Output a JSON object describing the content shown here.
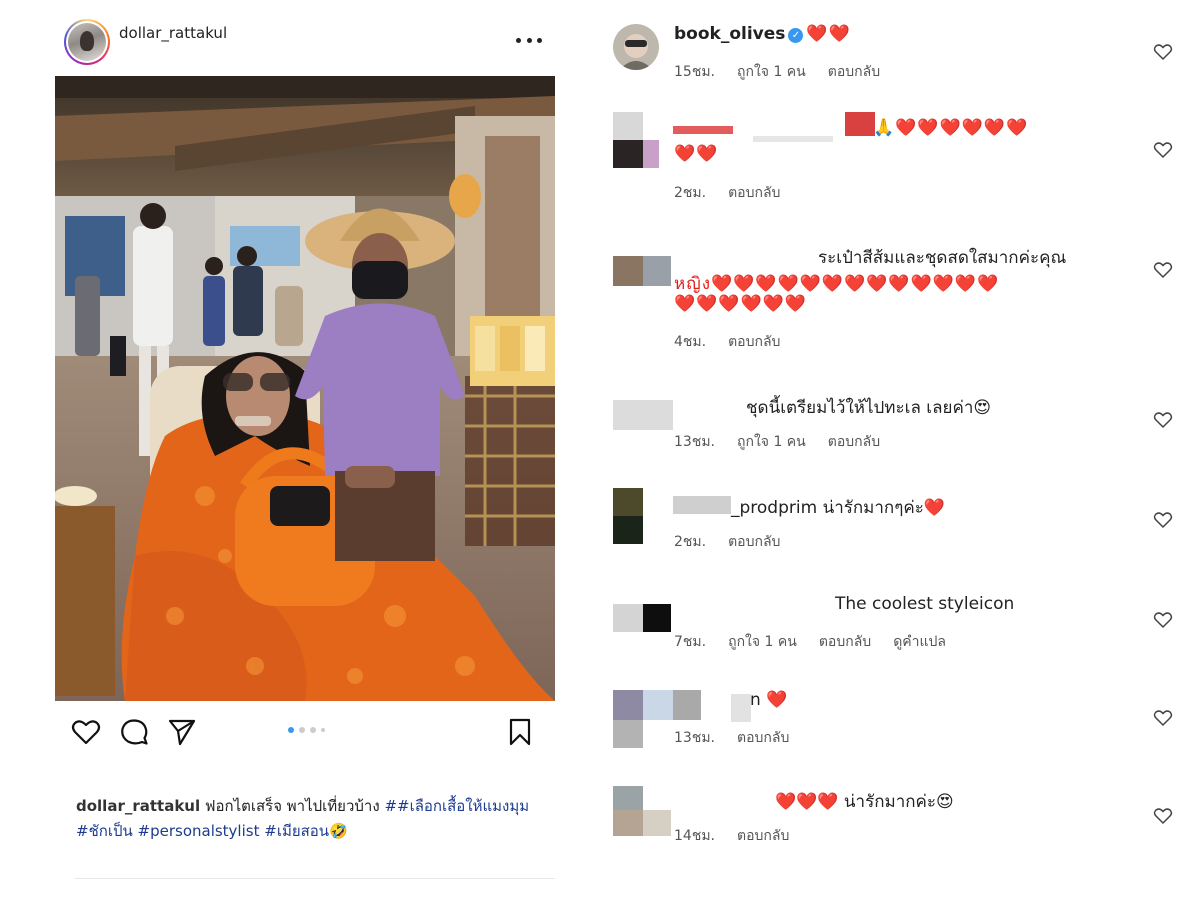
{
  "post": {
    "username": "dollar_rattakul",
    "caption_user": "dollar_rattakul",
    "caption_text": " ฟอกไตเสร็จ พาไปเที่ยวบ้าง ",
    "tag1": "##เลือกเสื้อให้แมงมุม",
    "tag2": "#ชักเป็น",
    "tag3": "#personalstylist",
    "tag4": "#เมียสอน",
    "caption_emoji": "🤣",
    "carousel_count": 4,
    "carousel_active": 1
  },
  "comments": [
    {
      "username": "book_olives",
      "text": "❤️❤️",
      "verified": true,
      "time": "15ชม.",
      "likes": "ถูกใจ 1 คน",
      "reply": "ตอบกลับ"
    },
    {
      "text_line1": "🙏❤️❤️❤️❤️❤️❤️",
      "text_line2": "❤️❤️",
      "time": "2ชม.",
      "reply": "ตอบกลับ"
    },
    {
      "text_line1": "ระเป๋าสีส้มและชุดสดใสมากค่ะคุณ",
      "text_line2": "หญิง❤️❤️❤️❤️❤️❤️❤️❤️❤️❤️❤️❤️❤️",
      "text_line3": "❤️❤️❤️❤️❤️❤️",
      "time": "4ชม.",
      "reply": "ตอบกลับ"
    },
    {
      "text": "ชุดนี้เตรียมไว้ให้ไปทะเล เลยค่า😍",
      "time": "13ชม.",
      "likes": "ถูกใจ 1 คน",
      "reply": "ตอบกลับ"
    },
    {
      "username_partial": "_prodprim",
      "text": " น่ารักมากๆค่ะ❤️",
      "time": "2ชม.",
      "reply": "ตอบกลับ"
    },
    {
      "text": "The coolest styleicon",
      "time": "7ชม.",
      "likes": "ถูกใจ 1 คน",
      "reply": "ตอบกลับ",
      "translate": "ดูคำแปล"
    },
    {
      "text": "n ❤️",
      "time": "13ชม.",
      "reply": "ตอบกลับ"
    },
    {
      "text": "❤️❤️❤️ น่ารักมากค่ะ😍",
      "time": "14ชม.",
      "reply": "ตอบกลับ"
    }
  ],
  "colors": {
    "heart": "#e0201b",
    "hashtag": "#1d3c8f",
    "verified": "#3897f0",
    "dot_active": "#3897f0"
  },
  "icons": [
    "more-icon",
    "like-icon",
    "comment-icon",
    "share-icon",
    "bookmark-icon",
    "heart-outline-icon",
    "verified-icon"
  ]
}
